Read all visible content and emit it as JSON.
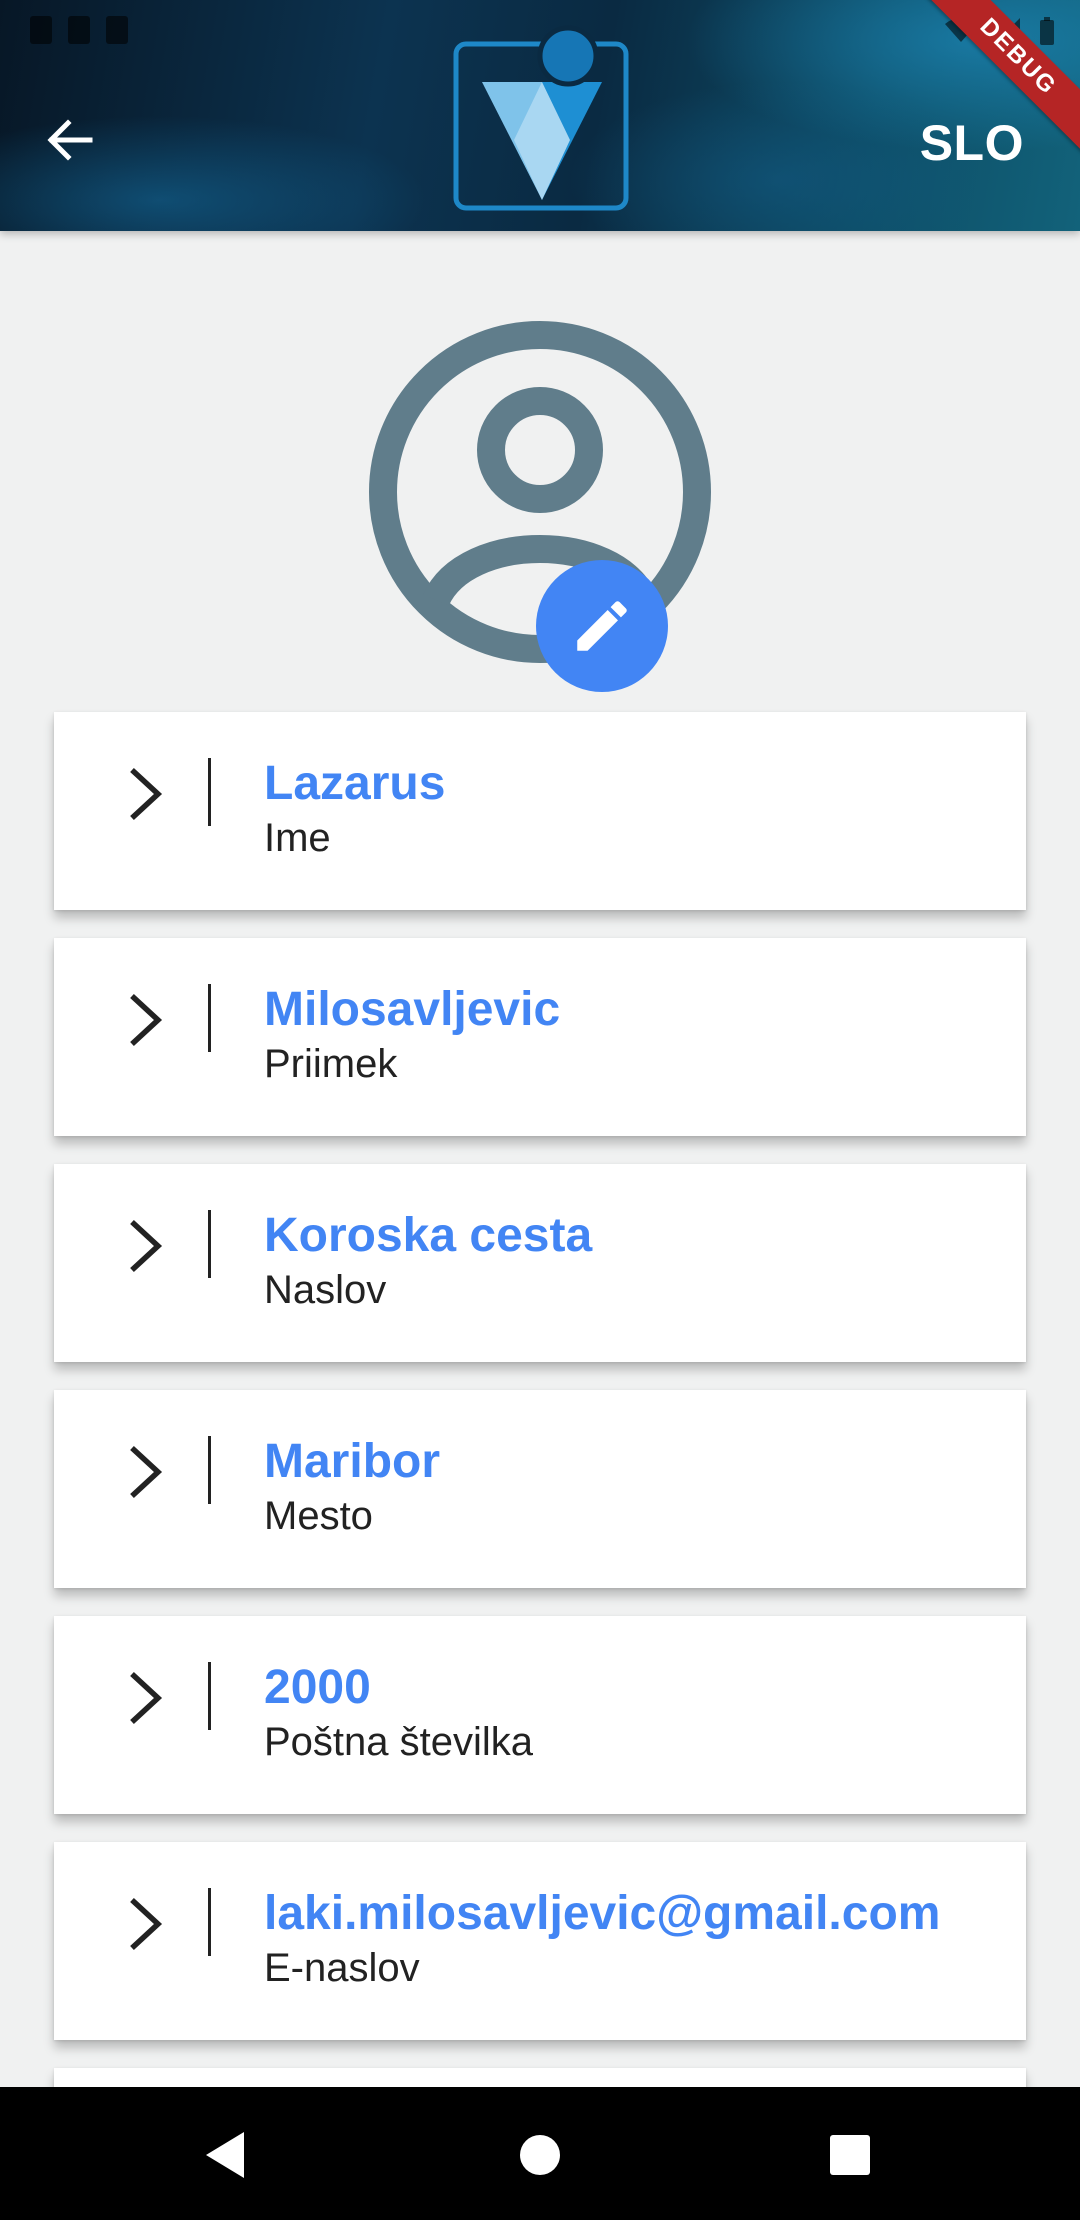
{
  "app": {
    "language_label": "SLO",
    "debug_label": "DEBUG"
  },
  "colors": {
    "accent": "#4285f4",
    "avatar": "#607d8b",
    "label": "#222222"
  },
  "icons": {
    "back": "arrow-left-icon",
    "avatar": "account-circle-icon",
    "edit": "pencil-icon",
    "chevron": "chevron-right-icon"
  },
  "profile": {
    "fields": [
      {
        "value": "Lazarus",
        "label": "Ime"
      },
      {
        "value": "Milosavljevic",
        "label": "Priimek"
      },
      {
        "value": "Koroska cesta",
        "label": "Naslov"
      },
      {
        "value": "Maribor",
        "label": "Mesto"
      },
      {
        "value": "2000",
        "label": "Poštna številka"
      },
      {
        "value": "laki.milosavljevic@gmail.com",
        "label": "E-naslov"
      }
    ]
  },
  "nav": {
    "back": "nav-back-icon",
    "home": "nav-home-icon",
    "recents": "nav-recents-icon"
  }
}
